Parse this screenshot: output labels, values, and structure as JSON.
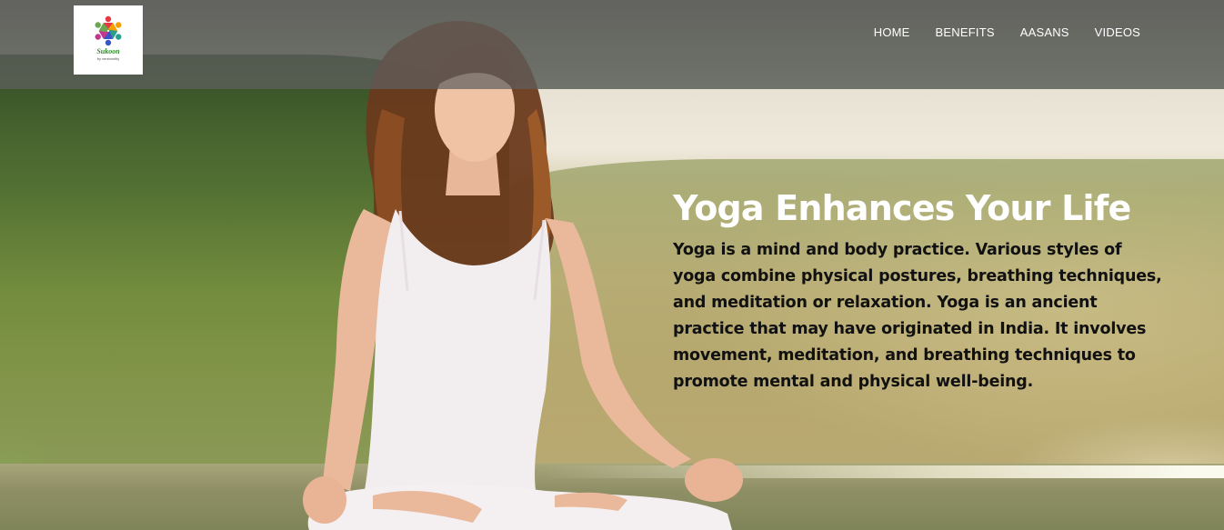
{
  "brand": {
    "name": "Sukoon",
    "tagline": "by ventonsfity",
    "logo_icon": "people-circle-logo-icon",
    "logo_colors": [
      "#e63946",
      "#f4a100",
      "#2a9d8f",
      "#3a56c5",
      "#c1398f",
      "#6aa84f"
    ]
  },
  "nav": {
    "items": [
      {
        "label": "HOME"
      },
      {
        "label": "BENEFITS"
      },
      {
        "label": "AASANS"
      },
      {
        "label": "VIDEOS"
      }
    ]
  },
  "hero": {
    "title": "Yoga Enhances Your Life",
    "description": "Yoga is a mind and body practice. Various styles of yoga combine physical postures, breathing techniques, and meditation or relaxation. Yoga is an ancient practice that may have originated in India. It involves movement, meditation, and breathing techniques to promote mental and physical well-being.",
    "image": "woman-meditating-by-lake-photo"
  },
  "colors": {
    "navbar_overlay": "#5f5f5f",
    "title": "#ffffff",
    "body_text": "#111111"
  }
}
